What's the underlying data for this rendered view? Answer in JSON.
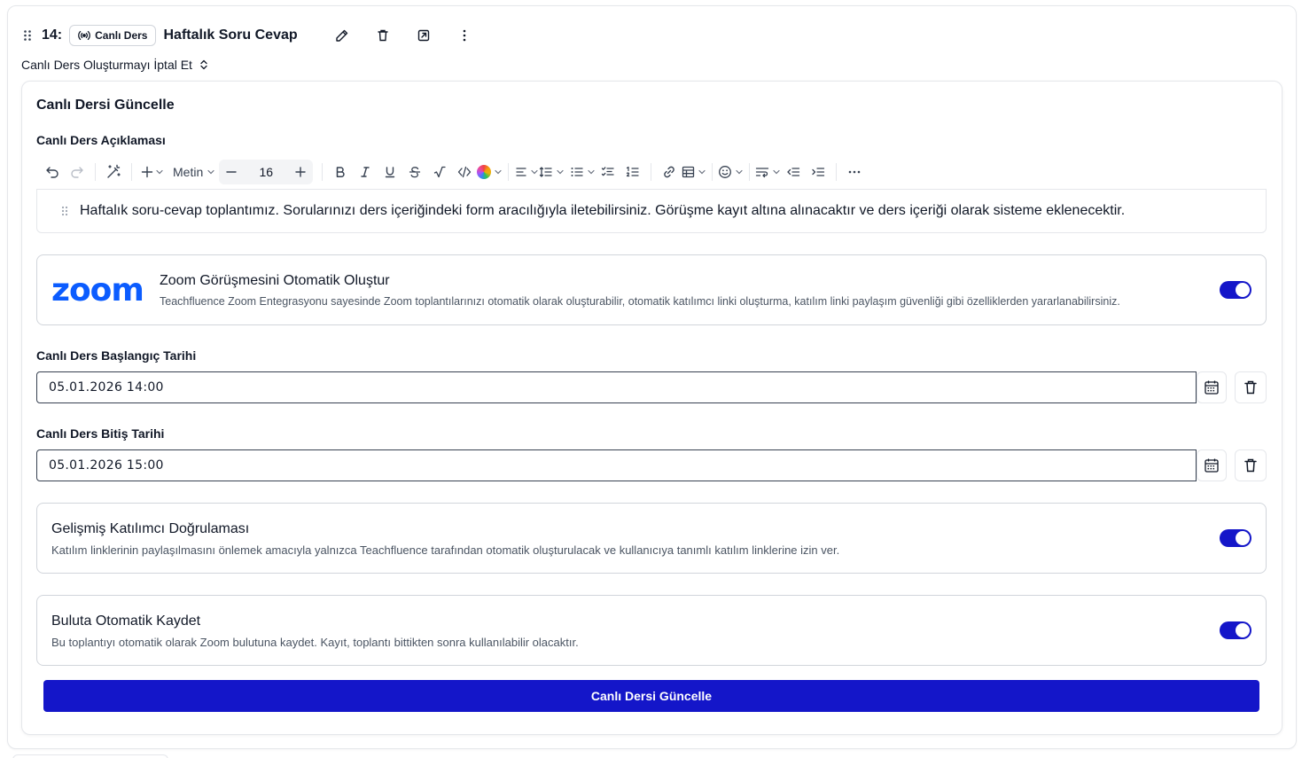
{
  "lesson": {
    "number": "14:",
    "badge_label": "Canlı Ders",
    "title": "Haftalık Soru Cevap",
    "header_icons": [
      "edit-icon",
      "trash-icon",
      "open-external-icon",
      "more-vertical-icon"
    ]
  },
  "cancel_select": {
    "label": "Canlı Ders Oluşturmayı İptal Et"
  },
  "form": {
    "title": "Canlı Dersi Güncelle",
    "description_label": "Canlı Ders Açıklaması",
    "toolbar": {
      "block_type": "Metin",
      "font_size": "16"
    },
    "description_text": "Haftalık soru-cevap toplantımız. Sorularınızı ders içeriğindeki form aracılığıyla iletebilirsiniz. Görüşme kayıt altına alınacaktır ve ders içeriği olarak sisteme eklenecektir.",
    "zoom": {
      "logo_text": "zoom",
      "title": "Zoom Görüşmesini Otomatik Oluştur",
      "description": "Teachfluence Zoom Entegrasyonu sayesinde Zoom toplantılarınızı otomatik olarak oluşturabilir, otomatik katılımcı linki oluşturma, katılım linki paylaşım güvenliği gibi özelliklerden yararlanabilirsiniz.",
      "enabled": true
    },
    "start_date": {
      "label": "Canlı Ders Başlangıç Tarihi",
      "value": "05.01.2026 14:00"
    },
    "end_date": {
      "label": "Canlı Ders Bitiş Tarihi",
      "value": "05.01.2026 15:00"
    },
    "advanced_auth": {
      "title": "Gelişmiş Katılımcı Doğrulaması",
      "description": "Katılım linklerinin paylaşılmasını önlemek amacıyla yalnızca Teachfluence tarafından otomatik oluşturulacak ve kullanıcıya tanımlı katılım linklerine izin ver.",
      "enabled": true
    },
    "cloud_record": {
      "title": "Buluta Otomatik Kaydet",
      "description": "Bu toplantıyı otomatik olarak Zoom bulutuna kaydet. Kayıt, toplantı bittikten sonra kullanılabilir olacaktır.",
      "enabled": true
    },
    "submit_label": "Canlı Dersi Güncelle"
  },
  "colors": {
    "primary": "#1416c9",
    "zoom_brand": "#0b5cff",
    "border": "#d1d5db"
  }
}
